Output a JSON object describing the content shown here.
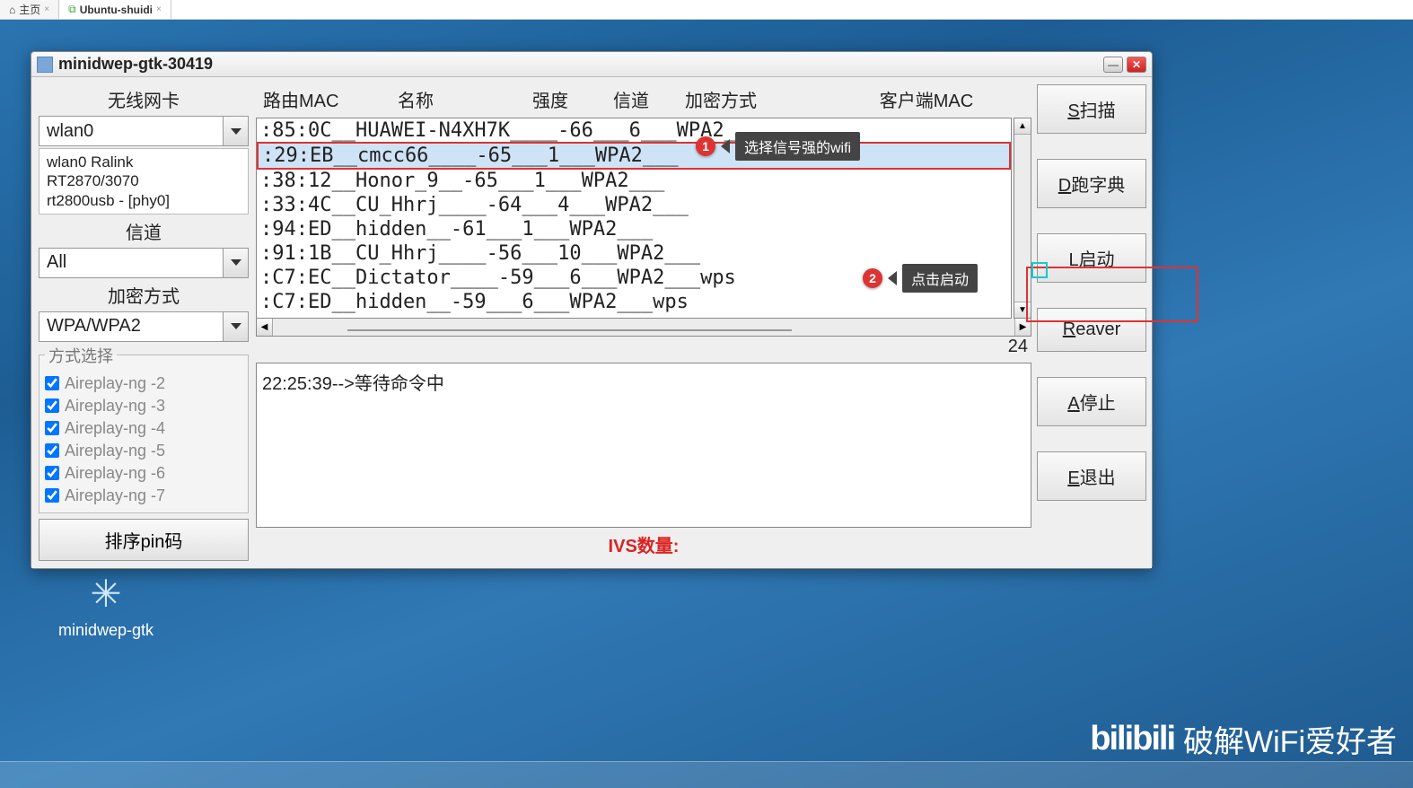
{
  "browser_tabs": [
    {
      "label": "主页",
      "icon": "home"
    },
    {
      "label": "Ubuntu-shuidi",
      "icon": "vm"
    }
  ],
  "window": {
    "title": "minidwep-gtk-30419",
    "left_panel": {
      "wireless_label": "无线网卡",
      "adapter_value": "wlan0",
      "adapter_info": "wlan0 Ralink\nRT2870/3070\nrt2800usb - [phy0]",
      "channel_label": "信道",
      "channel_value": "All",
      "enc_label": "加密方式",
      "enc_value": "WPA/WPA2",
      "method_legend": "方式选择",
      "methods": [
        "Aireplay-ng -2",
        "Aireplay-ng -3",
        "Aireplay-ng -4",
        "Aireplay-ng -5",
        "Aireplay-ng -6",
        "Aireplay-ng -7"
      ],
      "sort_button": "排序pin码"
    },
    "headers": {
      "router_mac": "路由MAC",
      "name": "名称",
      "strength": "强度",
      "channel": "信道",
      "enc": "加密方式",
      "client_mac": "客户端MAC"
    },
    "networks": [
      ":85:0C__HUAWEI-N4XH7K____-66___6___WPA2___",
      ":29:EB__cmcc66____-65___1___WPA2___",
      ":38:12__Honor_9__-65___1___WPA2___",
      ":33:4C__CU_Hhrj____-64___4___WPA2___",
      ":94:ED__hidden__-61___1___WPA2___",
      ":91:1B__CU_Hhrj____-56___10___WPA2___",
      ":C7:EC__Dictator____-59___6___WPA2___wps",
      ":C7:ED__hidden__-59___6___WPA2___wps"
    ],
    "selected_index": 1,
    "count": "24",
    "log_text": "22:25:39-->等待命令中",
    "ivs_label": "IVS数量:",
    "actions": {
      "scan": "S扫描",
      "dict": "D跑字典",
      "launch": "L启动",
      "reaver": "Reaver",
      "stop": "A停止",
      "exit": "E退出"
    }
  },
  "annotations": {
    "a1": {
      "num": "1",
      "text": "选择信号强的wifi"
    },
    "a2": {
      "num": "2",
      "text": "点击启动"
    }
  },
  "desktop_icon_label": "minidwep-gtk",
  "watermark": {
    "logo": "bilibili",
    "text": "破解WiFi爱好者"
  }
}
